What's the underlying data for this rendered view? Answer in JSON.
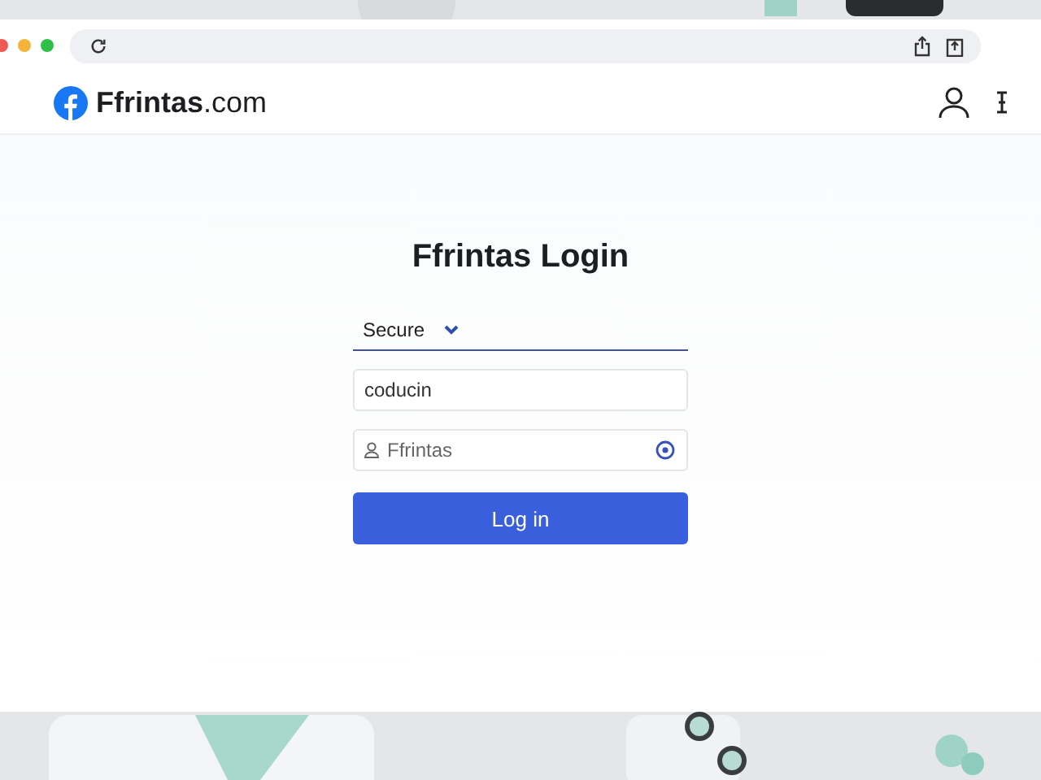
{
  "site": {
    "brand": "**Ffrintas**.com"
  },
  "login": {
    "title": "Ffrintas Login",
    "mode_select": {
      "value": "Secure"
    },
    "username": {
      "value": "coducin"
    },
    "account": {
      "placeholder": "Ffrintas"
    },
    "button": "Log in"
  }
}
